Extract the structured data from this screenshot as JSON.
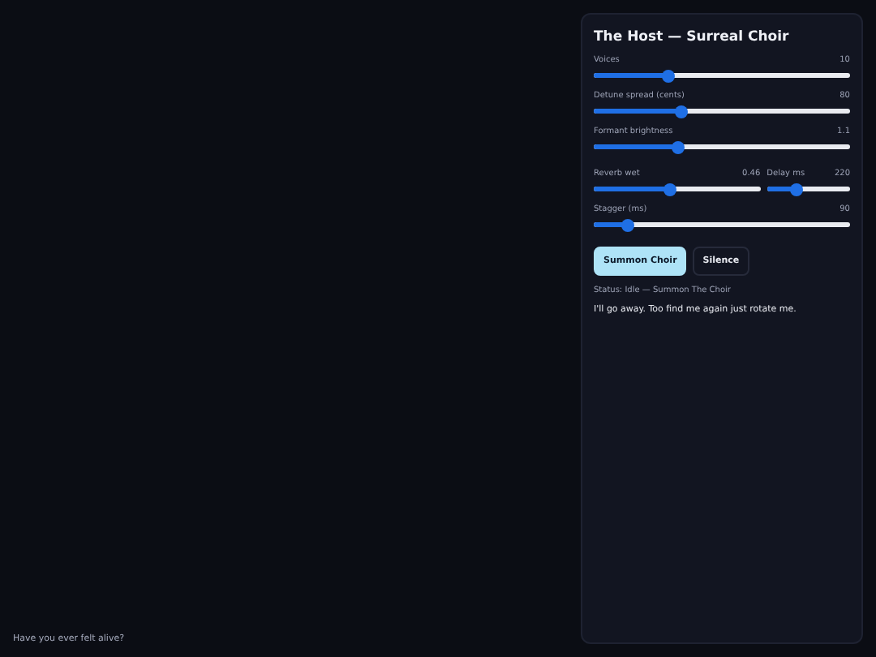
{
  "panel": {
    "title": "The Host — Surreal Choir",
    "sliders": [
      {
        "label": "Voices",
        "reading": "10",
        "level": 0.29
      },
      {
        "label": "Detune spread (cents)",
        "reading": "80",
        "level": 0.34
      },
      {
        "label": "Formant brightness",
        "reading": "1.1",
        "level": 0.33
      }
    ],
    "pair": [
      {
        "label": "Reverb wet",
        "reading": "0.46",
        "level": 0.46
      },
      {
        "label": "Delay ms",
        "reading": "220",
        "level": 0.36
      }
    ],
    "stagger": {
      "label": "Stagger (ms)",
      "reading": "90",
      "level": 0.13
    },
    "buttons": [
      {
        "label": "Summon Choir",
        "selected": true
      },
      {
        "label": "Silence",
        "selected": false
      }
    ],
    "status": "Status: Idle — Summon The Choir",
    "message": "I'll go away. Too find me again just rotate me."
  },
  "footer": "Have you ever felt alive?"
}
